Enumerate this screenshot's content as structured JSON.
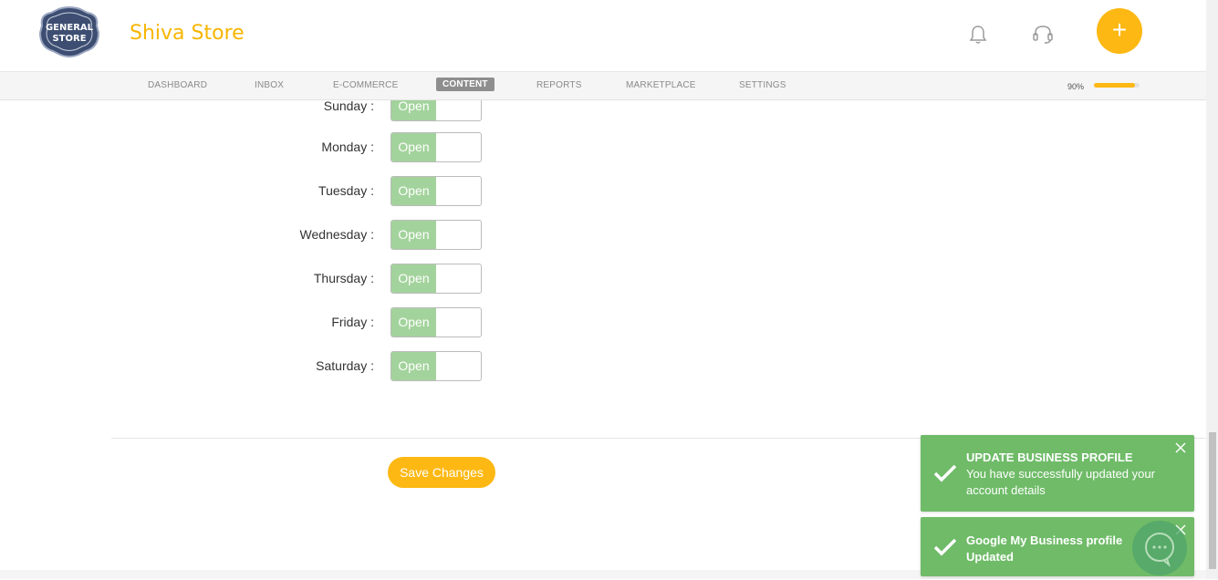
{
  "header": {
    "logo_text": "GENERAL STORE",
    "store_name": "Shiva Store",
    "plus_label": "+"
  },
  "nav": {
    "items": [
      "DASHBOARD",
      "INBOX",
      "E-COMMERCE",
      "CONTENT",
      "REPORTS",
      "MARKETPLACE",
      "SETTINGS"
    ],
    "active": "CONTENT",
    "progress_label": "90%",
    "progress_value": 0.9
  },
  "hours": [
    {
      "day": "Sunday :",
      "status": "Open"
    },
    {
      "day": "Monday :",
      "status": "Open"
    },
    {
      "day": "Tuesday :",
      "status": "Open"
    },
    {
      "day": "Wednesday :",
      "status": "Open"
    },
    {
      "day": "Thursday :",
      "status": "Open"
    },
    {
      "day": "Friday :",
      "status": "Open"
    },
    {
      "day": "Saturday :",
      "status": "Open"
    }
  ],
  "save_button": "Save Changes",
  "toasts": [
    {
      "title": "UPDATE BUSINESS PROFILE",
      "message": "You have successfully updated your account details"
    },
    {
      "title": "Google My Business profile Updated",
      "message": ""
    }
  ],
  "colors": {
    "brand": "#f7b500",
    "accent": "#fdb813",
    "toggle_on": "#a3d39c",
    "toast": "#6fbb68"
  }
}
